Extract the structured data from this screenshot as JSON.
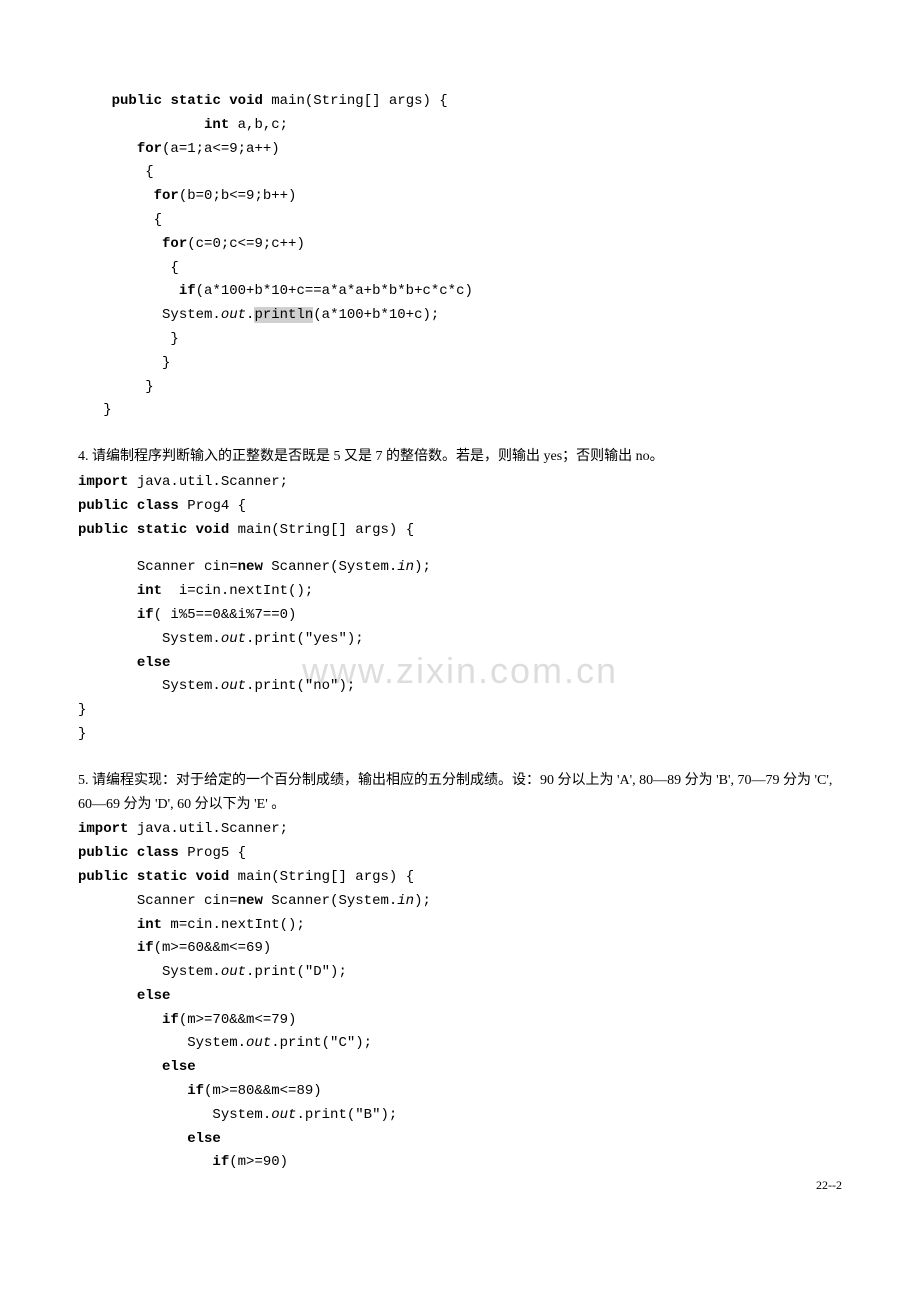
{
  "block1": {
    "l1a": "public",
    "l1b": "static",
    "l1c": "void",
    "l1d": " main(String[] args) {",
    "l2a": "int",
    "l2b": " a,b,c;",
    "l3a": "for",
    "l3b": "(a=1;a<=9;a++)",
    "l4": "{",
    "l5a": "for",
    "l5b": "(b=0;b<=9;b++)",
    "l6": "{",
    "l7a": "for",
    "l7b": "(c=0;c<=9;c++)",
    "l8": "{",
    "l9a": "if",
    "l9b": "(a*100+b*10+c==a*a*a+b*b*b+c*c*c)",
    "l10a": "System.",
    "l10b": "out",
    "l10c": ".",
    "l10d": "println",
    "l10e": "(a*100+b*10+c);",
    "l11": "}",
    "l12": "}",
    "l13": "}",
    "l14": "}"
  },
  "q4": {
    "prompt": "4. 请编制程序判断输入的正整数是否既是 5 又是 7 的整倍数。若是，则输出 yes；否则输出 no。",
    "l1a": "import",
    "l1b": " java.util.Scanner;",
    "l2a": "public",
    "l2b": "class",
    "l2c": " Prog4 {",
    "l3a": "public",
    "l3b": "static",
    "l3c": "void",
    "l3d": " main(String[] args) {",
    "l4a": "Scanner cin=",
    "l4b": "new",
    "l4c": " Scanner(System.",
    "l4d": "in",
    "l4e": ");",
    "l5a": "int",
    "l5b": "  i=cin.nextInt();",
    "l6a": "if",
    "l6b": "( i%5==0&&i%7==0)",
    "l7a": "System.",
    "l7b": "out",
    "l7c": ".print(\"yes\");",
    "l8": "else",
    "l9a": "System.",
    "l9b": "out",
    "l9c": ".print(\"no\");",
    "l10": "}",
    "l11": "}"
  },
  "q5": {
    "prompt": "5. 请编程实现：对于给定的一个百分制成绩，输出相应的五分制成绩。设：90 分以上为 'A', 80—89 分为 'B', 70—79 分为 'C', 60—69 分为 'D', 60 分以下为 'E' 。",
    "l1a": "import",
    "l1b": " java.util.Scanner;",
    "l2a": "public",
    "l2b": "class",
    "l2c": " Prog5 {",
    "l3a": "public",
    "l3b": "static",
    "l3c": "void",
    "l3d": " main(String[] args) {",
    "l4a": "Scanner cin=",
    "l4b": "new",
    "l4c": " Scanner(System.",
    "l4d": "in",
    "l4e": ");",
    "l5a": "int",
    "l5b": " m=cin.nextInt();",
    "l6a": "if",
    "l6b": "(m>=60&&m<=69)",
    "l7a": "System.",
    "l7b": "out",
    "l7c": ".print(\"D\");",
    "l8": "else",
    "l9a": "if",
    "l9b": "(m>=70&&m<=79)",
    "l10a": "System.",
    "l10b": "out",
    "l10c": ".print(\"C\");",
    "l11": "else",
    "l12a": "if",
    "l12b": "(m>=80&&m<=89)",
    "l13a": "System.",
    "l13b": "out",
    "l13c": ".print(\"B\");",
    "l14": "else",
    "l15a": "if",
    "l15b": "(m>=90)"
  },
  "watermark": "www.zixin.com.cn",
  "pagenum": "22--2"
}
